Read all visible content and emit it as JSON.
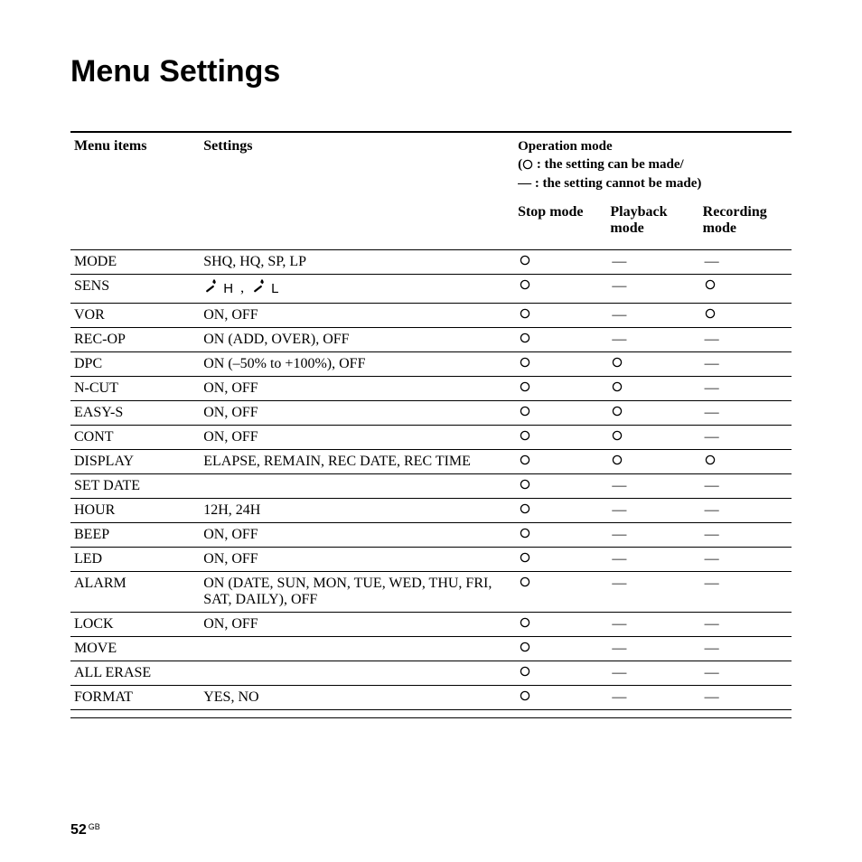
{
  "title": "Menu Settings",
  "headers": {
    "menu_items": "Menu items",
    "settings": "Settings",
    "operation_mode": "Operation mode",
    "legend_can": ": the setting can be made/",
    "legend_cannot": "— : the setting cannot be made)",
    "open_paren": "(",
    "stop_mode": "Stop mode",
    "playback_mode": "Playback mode",
    "recording_mode": "Recording mode"
  },
  "sens": {
    "sep": ",",
    "h": "H",
    "l": "L"
  },
  "rows": [
    {
      "name": "MODE",
      "settings": "SHQ, HQ, SP, LP",
      "stop": "O",
      "play": "-",
      "rec": "-"
    },
    {
      "name": "SENS",
      "settings": "__SENS__",
      "stop": "O",
      "play": "-",
      "rec": "O"
    },
    {
      "name": "VOR",
      "settings": "ON, OFF",
      "stop": "O",
      "play": "-",
      "rec": "O"
    },
    {
      "name": "REC-OP",
      "settings": "ON (ADD, OVER), OFF",
      "stop": "O",
      "play": "-",
      "rec": "-"
    },
    {
      "name": "DPC",
      "settings": "ON (–50% to +100%), OFF",
      "stop": "O",
      "play": "O",
      "rec": "-"
    },
    {
      "name": "N-CUT",
      "settings": "ON, OFF",
      "stop": "O",
      "play": "O",
      "rec": "-"
    },
    {
      "name": "EASY-S",
      "settings": "ON, OFF",
      "stop": "O",
      "play": "O",
      "rec": "-"
    },
    {
      "name": "CONT",
      "settings": "ON, OFF",
      "stop": "O",
      "play": "O",
      "rec": "-"
    },
    {
      "name": "DISPLAY",
      "settings": "ELAPSE, REMAIN, REC DATE, REC TIME",
      "stop": "O",
      "play": "O",
      "rec": "O"
    },
    {
      "name": "SET DATE",
      "settings": "",
      "stop": "O",
      "play": "-",
      "rec": "-"
    },
    {
      "name": "HOUR",
      "settings": "12H, 24H",
      "stop": "O",
      "play": "-",
      "rec": "-"
    },
    {
      "name": "BEEP",
      "settings": "ON, OFF",
      "stop": "O",
      "play": "-",
      "rec": "-"
    },
    {
      "name": "LED",
      "settings": "ON, OFF",
      "stop": "O",
      "play": "-",
      "rec": "-"
    },
    {
      "name": "ALARM",
      "settings": "ON (DATE, SUN, MON, TUE, WED, THU, FRI, SAT, DAILY), OFF",
      "stop": "O",
      "play": "-",
      "rec": "-"
    },
    {
      "name": "LOCK",
      "settings": "ON, OFF",
      "stop": "O",
      "play": "-",
      "rec": "-"
    },
    {
      "name": "MOVE",
      "settings": "",
      "stop": "O",
      "play": "-",
      "rec": "-"
    },
    {
      "name": "ALL ERASE",
      "settings": "",
      "stop": "O",
      "play": "-",
      "rec": "-"
    },
    {
      "name": "FORMAT",
      "settings": "YES, NO",
      "stop": "O",
      "play": "-",
      "rec": "-"
    }
  ],
  "footer": {
    "page": "52",
    "lang": "GB"
  }
}
